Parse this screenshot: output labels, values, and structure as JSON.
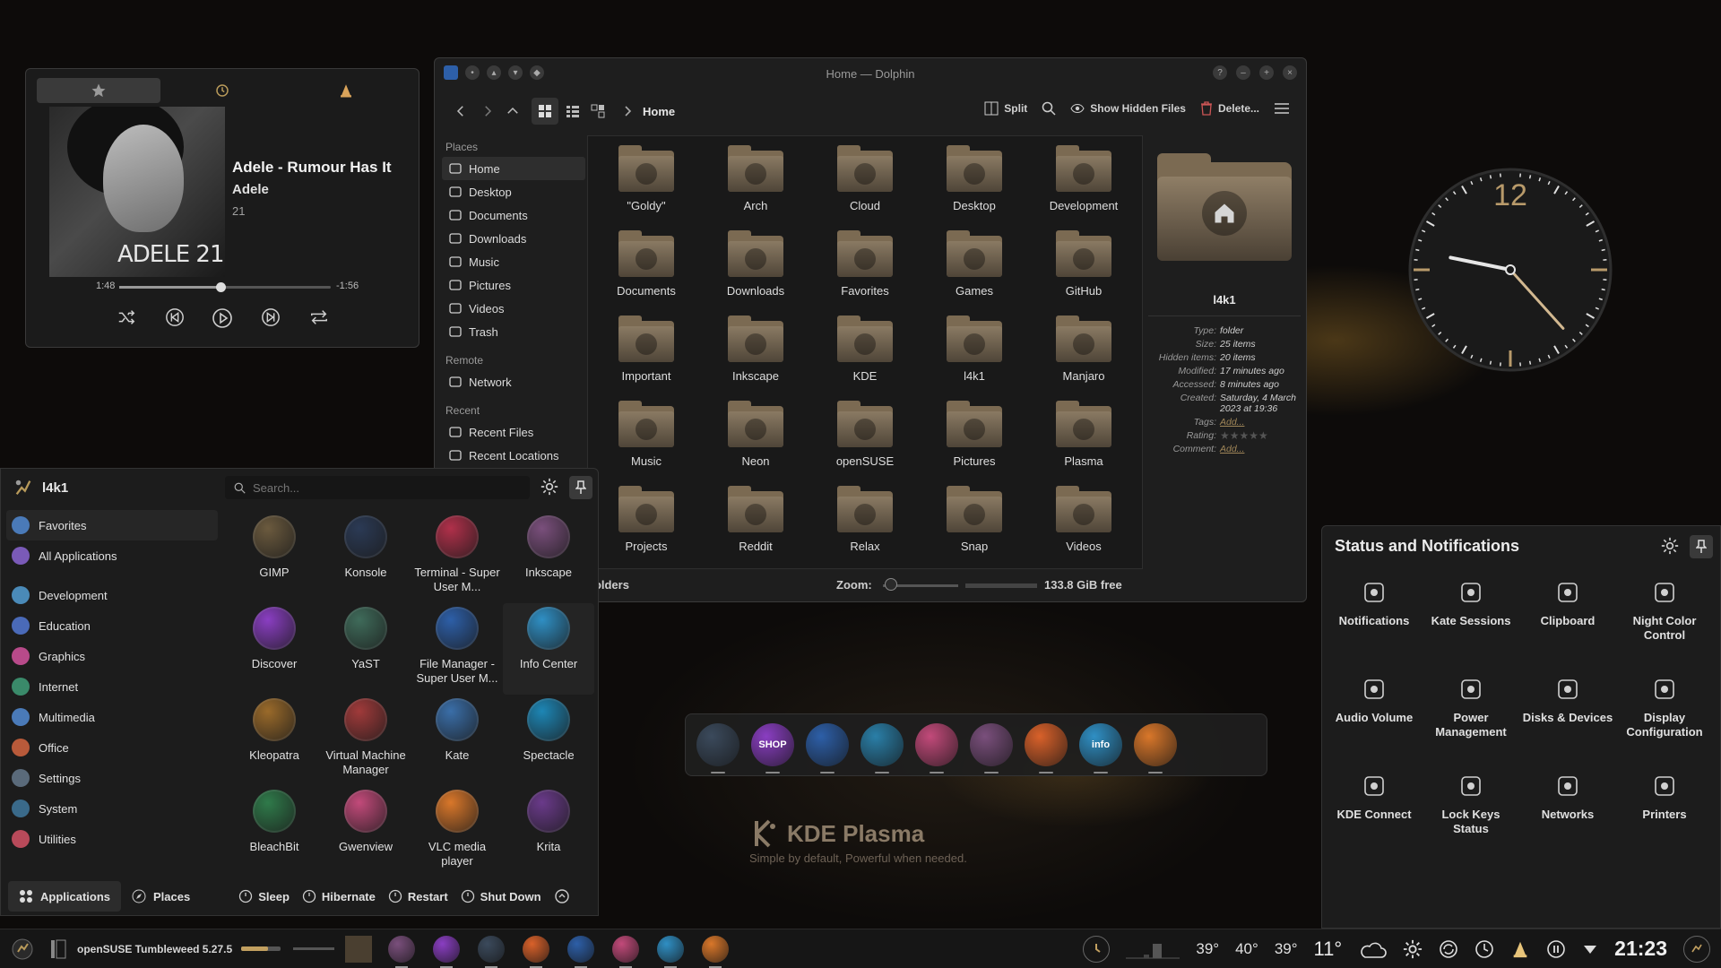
{
  "player": {
    "tabs": [
      "star-icon",
      "recent-icon",
      "vlc-icon"
    ],
    "song_title": "Adele - Rumour Has It",
    "artist": "Adele",
    "album": "21",
    "album_art_text": "ADELE 21",
    "elapsed": "1:48",
    "remaining": "-1:56",
    "progress": 0.48
  },
  "dolphin": {
    "window_title": "Home — Dolphin",
    "breadcrumb": "Home",
    "split_label": "Split",
    "hidden_files_label": "Show Hidden Files",
    "delete_label": "Delete...",
    "places_header": "Places",
    "places": [
      "Home",
      "Desktop",
      "Documents",
      "Downloads",
      "Music",
      "Pictures",
      "Videos",
      "Trash"
    ],
    "remote_header": "Remote",
    "remote": [
      "Network"
    ],
    "recent_header": "Recent",
    "recent": [
      "Recent Files",
      "Recent Locations"
    ],
    "folders": [
      "\"Goldy\"",
      "Arch",
      "Cloud",
      "Desktop",
      "Development",
      "Documents",
      "Downloads",
      "Favorites",
      "Games",
      "GitHub",
      "Important",
      "Inkscape",
      "KDE",
      "l4k1",
      "Manjaro",
      "Music",
      "Neon",
      "openSUSE",
      "Pictures",
      "Plasma",
      "Projects",
      "Reddit",
      "Relax",
      "Snap",
      "Videos"
    ],
    "status_folders": "Folders",
    "zoom_label": "Zoom:",
    "free_space": "133.8 GiB free",
    "info": {
      "name": "l4k1",
      "rows": [
        {
          "k": "Type:",
          "v": "folder"
        },
        {
          "k": "Size:",
          "v": "25 items"
        },
        {
          "k": "Hidden items:",
          "v": "20 items"
        },
        {
          "k": "Modified:",
          "v": "17 minutes ago"
        },
        {
          "k": "Accessed:",
          "v": "8 minutes ago"
        },
        {
          "k": "Created:",
          "v": "Saturday, 4 March 2023 at 19:36"
        }
      ],
      "tags_label": "Tags:",
      "tags_value": "Add...",
      "rating_label": "Rating:",
      "comment_label": "Comment:",
      "comment_value": "Add..."
    }
  },
  "launcher": {
    "user": "l4k1",
    "search_placeholder": "Search...",
    "categories": [
      "Favorites",
      "All Applications",
      "Development",
      "Education",
      "Graphics",
      "Internet",
      "Multimedia",
      "Office",
      "Settings",
      "System",
      "Utilities"
    ],
    "apps": [
      {
        "name": "GIMP",
        "color": "#6b5a3e"
      },
      {
        "name": "Konsole",
        "color": "#2b3a55"
      },
      {
        "name": "Terminal - Super User M...",
        "color": "#b0304a"
      },
      {
        "name": "Inkscape",
        "color": "#7a4f7c"
      },
      {
        "name": "Discover",
        "color": "#8a3ec2"
      },
      {
        "name": "YaST",
        "color": "#3f6b5a"
      },
      {
        "name": "File Manager - Super User M...",
        "color": "#2d5fa8"
      },
      {
        "name": "Info Center",
        "color": "#2f8fc4"
      },
      {
        "name": "Kleopatra",
        "color": "#9a6a2a"
      },
      {
        "name": "Virtual Machine Manager",
        "color": "#a03a3a"
      },
      {
        "name": "Kate",
        "color": "#3a6ea8"
      },
      {
        "name": "Spectacle",
        "color": "#1d86b5"
      },
      {
        "name": "BleachBit",
        "color": "#2f7a4a"
      },
      {
        "name": "Gwenview",
        "color": "#c24a7a"
      },
      {
        "name": "VLC media player",
        "color": "#d9772a"
      },
      {
        "name": "Krita",
        "color": "#6a3a8a"
      }
    ],
    "applications_tab": "Applications",
    "places_tab": "Places",
    "power": [
      "Sleep",
      "Hibernate",
      "Restart",
      "Shut Down"
    ]
  },
  "status": {
    "title": "Status and Notifications",
    "items": [
      "Notifications",
      "Kate Sessions",
      "Clipboard",
      "Night Color Control",
      "Audio Volume",
      "Power Management",
      "Disks & Devices",
      "Display Configuration",
      "KDE Connect",
      "Lock Keys Status",
      "Networks",
      "Printers"
    ]
  },
  "clock": {
    "numeral": "12",
    "hour": 9,
    "minute": 23
  },
  "dock": {
    "icons": [
      {
        "name": "settings-app-icon",
        "color": "#3b4a5c",
        "label": ""
      },
      {
        "name": "discover-icon",
        "color": "#8a3ec2",
        "label": "SHOP"
      },
      {
        "name": "dolphin-icon",
        "color": "#2d5fa8",
        "label": ""
      },
      {
        "name": "plasma-icon",
        "color": "#2a7fa8",
        "label": ""
      },
      {
        "name": "gwenview-icon",
        "color": "#c24a7a",
        "label": ""
      },
      {
        "name": "inkscape-icon",
        "color": "#7a4f7c",
        "label": ""
      },
      {
        "name": "firefox-icon",
        "color": "#d9612a",
        "label": ""
      },
      {
        "name": "info-center-icon",
        "color": "#2f8fc4",
        "label": "info"
      },
      {
        "name": "vlc-icon",
        "color": "#d9772a",
        "label": ""
      }
    ]
  },
  "kde": {
    "title": "KDE Plasma",
    "tagline": "Simple by default, Powerful when needed."
  },
  "taskbar": {
    "distro": "openSUSE Tumbleweed 5.27.5",
    "temps": [
      "39°",
      "40°",
      "39°"
    ],
    "weather": "11°",
    "time": "21:23"
  }
}
